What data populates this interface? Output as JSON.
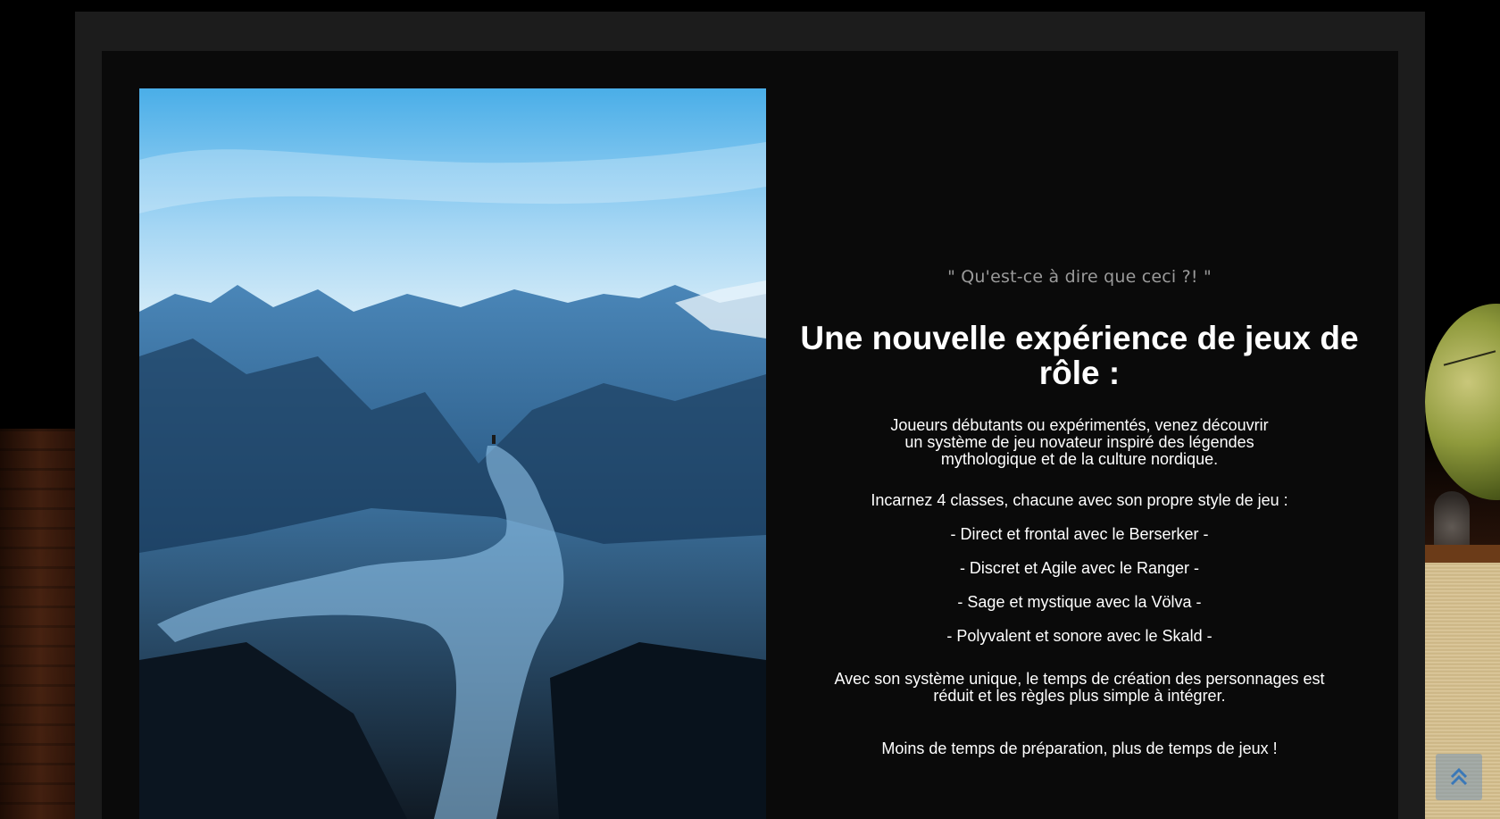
{
  "section": {
    "kicker": "\" Qu'est-ce à dire que ceci ?! \"",
    "headline": "Une nouvelle expérience de jeux de rôle :",
    "intro": "Joueurs débutants ou expérimentés, venez découvrir un système de jeu novateur inspiré des légendes mythologique et de la culture nordique.",
    "classes_intro": "Incarnez 4 classes, chacune avec son propre style de jeu :",
    "classes": [
      "- Direct et frontal avec le Berserker -",
      "- Discret et Agile avec le Ranger -",
      "- Sage et mystique avec la Völva -",
      "- Polyvalent et sonore avec le Skald -"
    ],
    "system": "Avec son système unique, le temps de création des personnages est réduit et les règles plus simple à intégrer.",
    "tagline": "Moins de temps de préparation, plus de temps de jeux !"
  },
  "image": {
    "subject": "icy-mountain-valley-photo"
  },
  "scroll_top": {
    "icon": "double-chevron-up-icon"
  },
  "colors": {
    "frame": "#1c1c1c",
    "panel": "#0a0a0a",
    "kicker": "#9a9a9a",
    "text": "#ffffff",
    "scroll_button": "#7896b4"
  }
}
